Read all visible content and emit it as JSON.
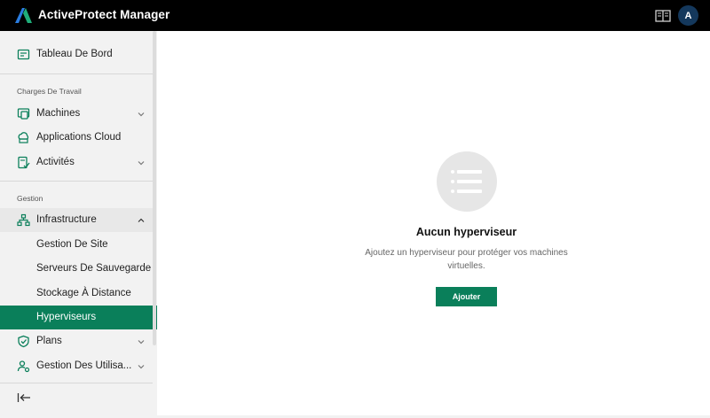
{
  "header": {
    "app_title": "ActiveProtect Manager",
    "avatar_initial": "A",
    "logo_icon": "activeprotect-logo-icon",
    "docs_icon": "book-icon",
    "accent": "#0a7f5a"
  },
  "sidebar": {
    "dashboard": {
      "label": "Tableau De Bord",
      "icon": "dashboard-icon"
    },
    "workloads_section": "Charges De Travail",
    "machines": {
      "label": "Machines",
      "icon": "machines-icon"
    },
    "cloud_apps": {
      "label": "Applications Cloud",
      "icon": "cloud-apps-icon"
    },
    "activities": {
      "label": "Activités",
      "icon": "activities-icon"
    },
    "management_section": "Gestion",
    "infrastructure": {
      "label": "Infrastructure",
      "icon": "infrastructure-icon"
    },
    "site_management": {
      "label": "Gestion De Site"
    },
    "backup_servers": {
      "label": "Serveurs De Sauvegarde"
    },
    "remote_storage": {
      "label": "Stockage À Distance"
    },
    "hypervisors": {
      "label": "Hyperviseurs"
    },
    "plans": {
      "label": "Plans",
      "icon": "shield-icon"
    },
    "user_management": {
      "label": "Gestion Des Utilisa...",
      "icon": "user-settings-icon"
    },
    "collapse_icon": "collapse-sidebar-icon"
  },
  "main": {
    "empty_icon": "list-icon",
    "empty_title": "Aucun hyperviseur",
    "empty_description": "Ajoutez un hyperviseur pour protéger vos machines virtuelles.",
    "add_button": "Ajouter"
  }
}
